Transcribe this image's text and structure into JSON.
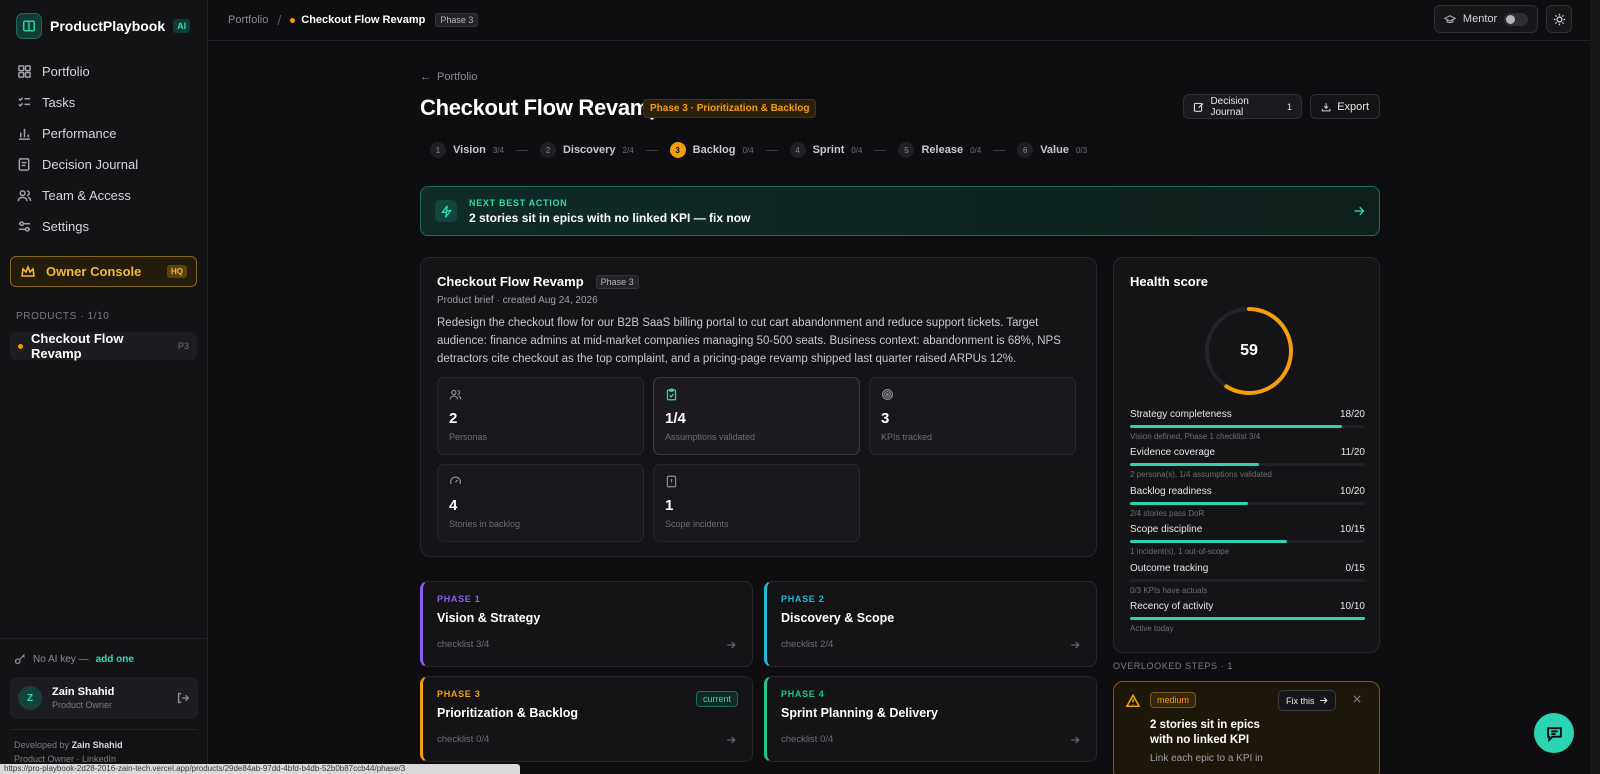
{
  "sidebar": {
    "brand": "ProductPlaybook",
    "brand_badge": "AI",
    "nav": [
      {
        "label": "Portfolio",
        "icon": "grid-icon"
      },
      {
        "label": "Tasks",
        "icon": "list-check-icon"
      },
      {
        "label": "Performance",
        "icon": "bar-chart-icon"
      },
      {
        "label": "Decision Journal",
        "icon": "journal-icon"
      },
      {
        "label": "Team & Access",
        "icon": "users-icon"
      },
      {
        "label": "Settings",
        "icon": "sliders-icon"
      }
    ],
    "owner_console": "Owner Console",
    "owner_badge": "HQ",
    "products_label": "PRODUCTS · 1/10",
    "product": {
      "name": "Checkout Flow Revamp",
      "phase": "P3"
    },
    "ai_key_text": "No AI key —",
    "ai_key_link": "add one",
    "user": {
      "initial": "Z",
      "name": "Zain Shahid",
      "role": "Product Owner"
    },
    "developed_by_prefix": "Developed by",
    "developer": "Zain Shahid",
    "dev_line2": "Product Owner · LinkedIn"
  },
  "statusbar_url": "https://pro-playbook-2d28-2016-zain-tech.vercel.app/products/29de84ab-97dd-4bfd-b4db-52b0b87ccb44/phase/3",
  "topbar": {
    "crumb_root": "Portfolio",
    "separator": "/",
    "current": "Checkout Flow Revamp",
    "phase_badge": "Phase 3",
    "mentor_label": "Mentor"
  },
  "page": {
    "back_label": "Portfolio",
    "title": "Checkout Flow Revamp",
    "phase_badge": "Phase 3 · Prioritization & Backlog",
    "decision_journal_label": "Decision Journal",
    "decision_journal_count": "1",
    "export_label": "Export"
  },
  "steps": [
    {
      "num": "1",
      "label": "Vision",
      "count": "3/4",
      "active": false
    },
    {
      "num": "2",
      "label": "Discovery",
      "count": "2/4",
      "active": false
    },
    {
      "num": "3",
      "label": "Backlog",
      "count": "0/4",
      "active": true
    },
    {
      "num": "4",
      "label": "Sprint",
      "count": "0/4",
      "active": false
    },
    {
      "num": "5",
      "label": "Release",
      "count": "0/4",
      "active": false
    },
    {
      "num": "6",
      "label": "Value",
      "count": "0/3",
      "active": false
    }
  ],
  "next_action": {
    "label": "NEXT BEST ACTION",
    "text": "2 stories sit in epics with no linked KPI — fix now"
  },
  "brief": {
    "title": "Checkout Flow Revamp",
    "phase": "Phase 3",
    "subtitle": "Product brief · created Aug 24, 2026",
    "description": "Redesign the checkout flow for our B2B SaaS billing portal to cut cart abandonment and reduce support tickets. Target audience: finance admins at mid-market companies managing 50-500 seats. Business context: abandonment is 68%, NPS detractors cite checkout as the top complaint, and a pricing-page revamp shipped last quarter raised ARPUs 12%.",
    "stats": [
      {
        "value": "2",
        "label": "Personas",
        "icon": "users-icon"
      },
      {
        "value": "1/4",
        "label": "Assumptions validated",
        "icon": "clipboard-check-icon"
      },
      {
        "value": "3",
        "label": "KPIs tracked",
        "icon": "target-icon"
      },
      {
        "value": "4",
        "label": "Stories in backlog",
        "icon": "gauge-icon"
      },
      {
        "value": "1",
        "label": "Scope incidents",
        "icon": "alert-file-icon"
      }
    ]
  },
  "phases": [
    {
      "label": "PHASE 1",
      "name": "Vision & Strategy",
      "checklist": "checklist 3/4",
      "color": "#8b5cf6"
    },
    {
      "label": "PHASE 2",
      "name": "Discovery & Scope",
      "checklist": "checklist 2/4",
      "color": "#22b8d6"
    },
    {
      "label": "PHASE 3",
      "name": "Prioritization & Backlog",
      "checklist": "checklist 0/4",
      "color": "#f59e0b",
      "current": "current"
    },
    {
      "label": "PHASE 4",
      "name": "Sprint Planning & Delivery",
      "checklist": "checklist 0/4",
      "color": "#22c58b"
    }
  ],
  "health": {
    "title": "Health score",
    "score": 59,
    "max": 100,
    "metrics": [
      {
        "name": "Strategy completeness",
        "score": "18/20",
        "value": 18,
        "max": 20,
        "note": "Vision defined, Phase 1 checklist 3/4"
      },
      {
        "name": "Evidence coverage",
        "score": "11/20",
        "value": 11,
        "max": 20,
        "note": "2 persona(s), 1/4 assumptions validated"
      },
      {
        "name": "Backlog readiness",
        "score": "10/20",
        "value": 10,
        "max": 20,
        "note": "2/4 stories pass DoR"
      },
      {
        "name": "Scope discipline",
        "score": "10/15",
        "value": 10,
        "max": 15,
        "note": "1 incident(s), 1 out-of-scope"
      },
      {
        "name": "Outcome tracking",
        "score": "0/15",
        "value": 0,
        "max": 15,
        "note": "0/3 KPIs have actuals"
      },
      {
        "name": "Recency of activity",
        "score": "10/10",
        "value": 10,
        "max": 10,
        "note": "Active today"
      }
    ]
  },
  "overlooked": {
    "label": "OVERLOOKED STEPS · 1",
    "severity": "medium",
    "fix_label": "Fix this",
    "title": "2 stories sit in epics with no linked KPI",
    "desc": "Link each epic to a KPI in"
  },
  "colors": {
    "accent": "#2dd4b4",
    "warning": "#f59e0b",
    "background": "#0e0e11"
  }
}
